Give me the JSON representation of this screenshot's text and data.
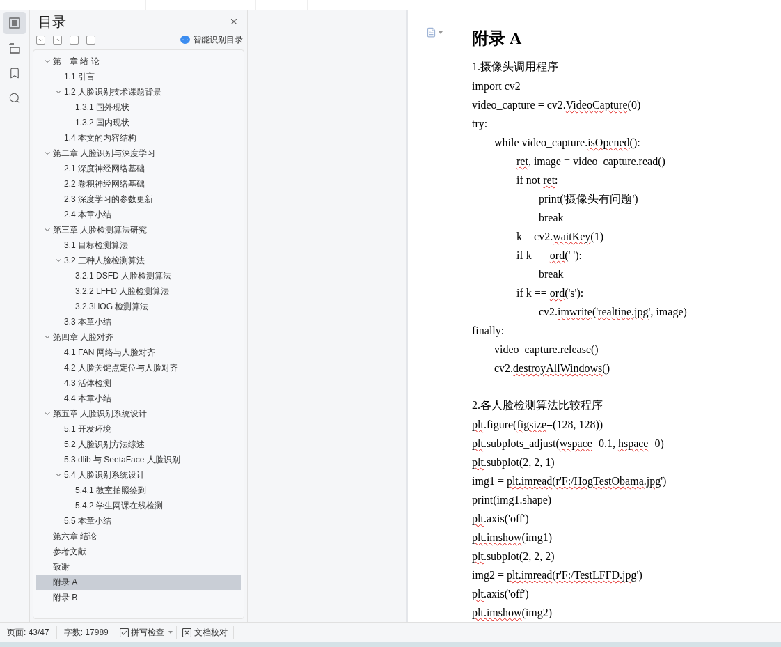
{
  "rail_tabs": [
    {
      "selected": true
    },
    {
      "selected": false
    },
    {
      "selected": false
    },
    {
      "selected": false
    }
  ],
  "toc_panel": {
    "title": "目录",
    "smart_button": "智能识别目录",
    "items": [
      {
        "label": "第一章  绪  论",
        "expanded": true,
        "selected": false,
        "children": [
          {
            "label": "1.1  引言",
            "selected": false
          },
          {
            "label": "1.2  人脸识别技术课题背景",
            "expanded": true,
            "selected": false,
            "children": [
              {
                "label": "1.3.1  国外现状",
                "selected": false
              },
              {
                "label": "1.3.2  国内现状",
                "selected": false
              }
            ]
          },
          {
            "label": "1.4  本文的内容结构",
            "selected": false
          }
        ]
      },
      {
        "label": "第二章  人脸识别与深度学习",
        "expanded": true,
        "selected": false,
        "children": [
          {
            "label": "2.1 深度神经网络基础",
            "selected": false
          },
          {
            "label": "2.2 卷积神经网络基础",
            "selected": false
          },
          {
            "label": "2.3  深度学习的参数更新",
            "selected": false
          },
          {
            "label": "2.4 本章小结",
            "selected": false
          }
        ]
      },
      {
        "label": "第三章  人脸检测算法研究",
        "expanded": true,
        "selected": false,
        "children": [
          {
            "label": "3.1 目标检测算法",
            "selected": false
          },
          {
            "label": "3.2 三种人脸检测算法",
            "expanded": true,
            "selected": false,
            "children": [
              {
                "label": "3.2.1 DSFD 人脸检测算法",
                "selected": false
              },
              {
                "label": "3.2.2 LFFD 人脸检测算法",
                "selected": false
              },
              {
                "label": "3.2.3HOG 检测算法",
                "selected": false
              }
            ]
          },
          {
            "label": "3.3  本章小结",
            "selected": false
          }
        ]
      },
      {
        "label": "第四章  人脸对齐",
        "expanded": true,
        "selected": false,
        "children": [
          {
            "label": "4.1 FAN 网络与人脸对齐",
            "selected": false
          },
          {
            "label": "4.2 人脸关键点定位与人脸对齐",
            "selected": false
          },
          {
            "label": "4.3 活体检测",
            "selected": false
          },
          {
            "label": "4.4  本章小结",
            "selected": false
          }
        ]
      },
      {
        "label": "第五章  人脸识别系统设计",
        "expanded": true,
        "selected": false,
        "children": [
          {
            "label": "5.1  开发环境",
            "selected": false
          },
          {
            "label": "5.2 人脸识别方法综述",
            "selected": false
          },
          {
            "label": "5.3 dlib 与 SeetaFace 人脸识别",
            "selected": false
          },
          {
            "label": "5.4  人脸识别系统设计",
            "expanded": true,
            "selected": false,
            "children": [
              {
                "label": "5.4.1  教室拍照签到",
                "selected": false
              },
              {
                "label": "5.4.2  学生网课在线检测",
                "selected": false
              }
            ]
          },
          {
            "label": "5.5 本章小结",
            "selected": false
          }
        ]
      },
      {
        "label": "第六章  结论",
        "selected": false
      },
      {
        "label": "参考文献",
        "selected": false
      },
      {
        "label": "致谢",
        "selected": false
      },
      {
        "label": "附录 A",
        "selected": true
      },
      {
        "label": "附录 B",
        "selected": false
      }
    ]
  },
  "document": {
    "heading": "附录 A",
    "sections": [
      {
        "title": "1.摄像头调用程序",
        "lines": [
          {
            "parts": [
              {
                "text": "import cv2",
                "flagged": false
              }
            ]
          },
          {
            "parts": [
              {
                "text": "video_capture = cv2.",
                "flagged": false
              },
              {
                "text": "VideoCapture",
                "flagged": true
              },
              {
                "text": "(0)",
                "flagged": false
              }
            ]
          },
          {
            "parts": [
              {
                "text": "try:",
                "flagged": false
              }
            ],
            "children": [
              {
                "parts": [
                  {
                    "text": "while video_capture.",
                    "flagged": false
                  },
                  {
                    "text": "isOpened",
                    "flagged": true
                  },
                  {
                    "text": "():",
                    "flagged": false
                  }
                ],
                "children": [
                  {
                    "parts": [
                      {
                        "text": "ret",
                        "flagged": true
                      },
                      {
                        "text": ", image = video_capture.read()",
                        "flagged": false
                      }
                    ]
                  },
                  {
                    "parts": [
                      {
                        "text": "if not ",
                        "flagged": false
                      },
                      {
                        "text": "ret",
                        "flagged": true
                      },
                      {
                        "text": ":",
                        "flagged": false
                      }
                    ],
                    "children": [
                      {
                        "parts": [
                          {
                            "text": "print('摄像头有问题')",
                            "flagged": false
                          }
                        ]
                      },
                      {
                        "parts": [
                          {
                            "text": "break",
                            "flagged": false
                          }
                        ]
                      }
                    ]
                  },
                  {
                    "parts": [
                      {
                        "text": "k = cv2.",
                        "flagged": false
                      },
                      {
                        "text": "waitKey",
                        "flagged": true
                      },
                      {
                        "text": "(1)",
                        "flagged": false
                      }
                    ]
                  },
                  {
                    "parts": [
                      {
                        "text": "if k == ",
                        "flagged": false
                      },
                      {
                        "text": "ord",
                        "flagged": true
                      },
                      {
                        "text": "(' '):",
                        "flagged": false
                      }
                    ],
                    "children": [
                      {
                        "parts": [
                          {
                            "text": "break",
                            "flagged": false
                          }
                        ]
                      }
                    ]
                  },
                  {
                    "parts": [
                      {
                        "text": "if k == ",
                        "flagged": false
                      },
                      {
                        "text": "ord",
                        "flagged": true
                      },
                      {
                        "text": "('s'):",
                        "flagged": false
                      }
                    ],
                    "children": [
                      {
                        "parts": [
                          {
                            "text": "cv2.",
                            "flagged": false
                          },
                          {
                            "text": "imwrite",
                            "flagged": true
                          },
                          {
                            "text": "('",
                            "flagged": false
                          },
                          {
                            "text": "realtine.jpg",
                            "flagged": true
                          },
                          {
                            "text": "', image)",
                            "flagged": false
                          }
                        ]
                      }
                    ]
                  }
                ]
              }
            ]
          },
          {
            "parts": [
              {
                "text": "finally:",
                "flagged": false
              }
            ],
            "children": [
              {
                "parts": [
                  {
                    "text": "video_capture.release()",
                    "flagged": false
                  }
                ]
              },
              {
                "parts": [
                  {
                    "text": "cv2.",
                    "flagged": false
                  },
                  {
                    "text": "destroyAllWindows",
                    "flagged": true
                  },
                  {
                    "text": "()",
                    "flagged": false
                  }
                ]
              }
            ]
          }
        ]
      },
      {
        "title": "2.各人脸检测算法比较程序",
        "lines": [
          {
            "parts": [
              {
                "text": "plt",
                "flagged": true
              },
              {
                "text": ".figure(",
                "flagged": false
              },
              {
                "text": "figsize",
                "flagged": true
              },
              {
                "text": "=(128, 128))",
                "flagged": false
              }
            ]
          },
          {
            "parts": [
              {
                "text": "plt",
                "flagged": true
              },
              {
                "text": ".subplots_adjust(",
                "flagged": false
              },
              {
                "text": "wspace",
                "flagged": true
              },
              {
                "text": "=0.1, ",
                "flagged": false
              },
              {
                "text": "hspace",
                "flagged": true
              },
              {
                "text": "=0)",
                "flagged": false
              }
            ]
          },
          {
            "parts": [
              {
                "text": "plt",
                "flagged": true
              },
              {
                "text": ".subplot(2, 2, 1)",
                "flagged": false
              }
            ]
          },
          {
            "parts": [
              {
                "text": "img1 = ",
                "flagged": false
              },
              {
                "text": "plt.imread",
                "flagged": true
              },
              {
                "text": "(",
                "flagged": false
              },
              {
                "text": "r'F:/HogTestObama.jpg",
                "flagged": true
              },
              {
                "text": "')",
                "flagged": false
              }
            ]
          },
          {
            "parts": [
              {
                "text": "print(img1.shape)",
                "flagged": false
              }
            ]
          },
          {
            "parts": [
              {
                "text": "plt",
                "flagged": true
              },
              {
                "text": ".axis('off')",
                "flagged": false
              }
            ]
          },
          {
            "parts": [
              {
                "text": "plt.imshow",
                "flagged": true
              },
              {
                "text": "(img1)",
                "flagged": false
              }
            ]
          },
          {
            "parts": [
              {
                "text": "plt",
                "flagged": true
              },
              {
                "text": ".subplot(2, 2, 2)",
                "flagged": false
              }
            ]
          },
          {
            "parts": [
              {
                "text": "img2 = ",
                "flagged": false
              },
              {
                "text": "plt.imread",
                "flagged": true
              },
              {
                "text": "(",
                "flagged": false
              },
              {
                "text": "r'F:/TestLFFD.jpg",
                "flagged": true
              },
              {
                "text": "')",
                "flagged": false
              }
            ]
          },
          {
            "parts": [
              {
                "text": "plt",
                "flagged": true
              },
              {
                "text": ".axis('off')",
                "flagged": false
              }
            ]
          },
          {
            "parts": [
              {
                "text": "plt.imshow",
                "flagged": true
              },
              {
                "text": "(img2)",
                "flagged": false
              }
            ]
          }
        ]
      }
    ]
  },
  "status_bar": {
    "page": "页面: 43/47",
    "word_count": "字数: 17989",
    "spell_check": "拼写检查",
    "proofread": "文档校对"
  }
}
